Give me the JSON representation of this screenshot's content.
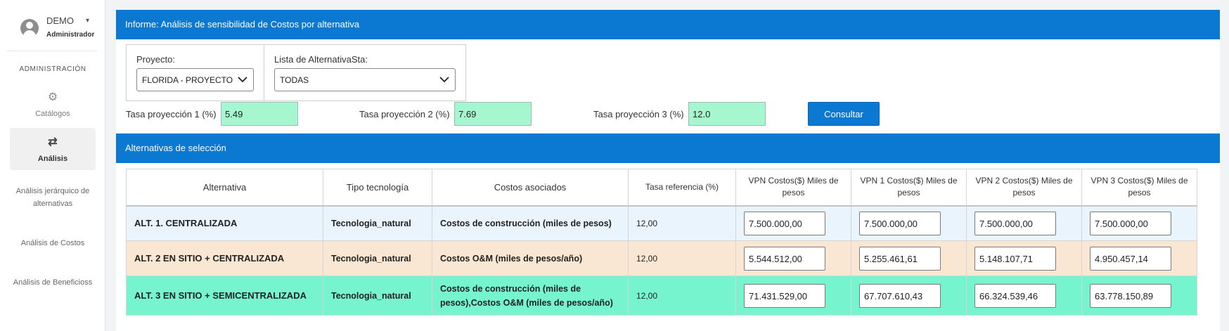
{
  "user": {
    "name": "DEMO",
    "role": "Administrador"
  },
  "sidebar": {
    "section": "ADMINISTRACIÓN",
    "items": [
      {
        "icon": "gears-icon",
        "label": "Catálogos"
      },
      {
        "icon": "exchange-arrows-icon",
        "label": "Análisis"
      }
    ],
    "sub_items": [
      "Análisis jerárquico de alternativas",
      "Análisis de Costos",
      "Análisis de Beneficioss"
    ]
  },
  "report": {
    "title": "Informe: Análisis de sensibilidad de Costos por alternativa",
    "proyecto_label": "Proyecto:",
    "proyecto_value": "FLORIDA - PROYECTO",
    "lista_label": "Lista de AlternativaSta:",
    "lista_value": "TODAS",
    "tasas": [
      {
        "label": "Tasa proyección 1 (%)",
        "value": "5.49"
      },
      {
        "label": "Tasa proyección 2 (%)",
        "value": "7.69"
      },
      {
        "label": "Tasa proyección 3 (%)",
        "value": "12.0"
      }
    ],
    "consultar_label": "Consultar"
  },
  "alternativas": {
    "title": "Alternativas de selección",
    "columns": [
      "Alternativa",
      "Tipo tecnología",
      "Costos asociados",
      "Tasa referencia (%)",
      "VPN Costos($) Miles de pesos",
      "VPN 1 Costos($) Miles de pesos",
      "VPN 2 Costos($) Miles de pesos",
      "VPN 3 Costos($) Miles de pesos"
    ],
    "rows": [
      {
        "alternativa": "ALT. 1. CENTRALIZADA",
        "tipo": "Tecnologia_natural",
        "costos": "Costos de construcción (miles de pesos)",
        "tasa": "12,00",
        "vpn": "7.500.000,00",
        "vpn1": "7.500.000,00",
        "vpn2": "7.500.000,00",
        "vpn3": "7.500.000,00"
      },
      {
        "alternativa": "ALT. 2 EN SITIO + CENTRALIZADA",
        "tipo": "Tecnologia_natural",
        "costos": "Costos O&M (miles de pesos/año)",
        "tasa": "12,00",
        "vpn": "5.544.512,00",
        "vpn1": "5.255.461,61",
        "vpn2": "5.148.107,71",
        "vpn3": "4.950.457,14"
      },
      {
        "alternativa": "ALT. 3 EN SITIO + SEMICENTRALIZADA",
        "tipo": "Tecnologia_natural",
        "costos": "Costos de construcción (miles de pesos),Costos O&M (miles de pesos/año)",
        "tasa": "12,00",
        "vpn": "71.431.529,00",
        "vpn1": "67.707.610,43",
        "vpn2": "66.324.539,46",
        "vpn3": "63.778.150,89"
      }
    ]
  }
}
